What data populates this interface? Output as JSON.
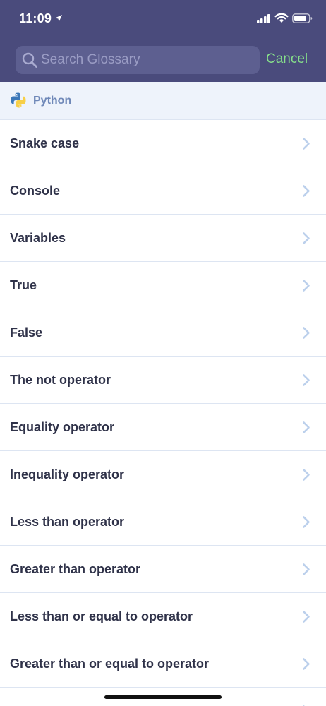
{
  "status_bar": {
    "time": "11:09"
  },
  "search": {
    "placeholder": "Search Glossary",
    "value": "",
    "cancel_label": "Cancel"
  },
  "section": {
    "title": "Python",
    "icon": "python-logo"
  },
  "items": [
    {
      "label": "Snake case"
    },
    {
      "label": "Console"
    },
    {
      "label": "Variables"
    },
    {
      "label": "True"
    },
    {
      "label": "False"
    },
    {
      "label": "The not operator"
    },
    {
      "label": "Equality operator"
    },
    {
      "label": "Inequality operator"
    },
    {
      "label": "Less than operator"
    },
    {
      "label": "Greater than operator"
    },
    {
      "label": "Less than or equal to operator"
    },
    {
      "label": "Greater than or equal to operator"
    }
  ],
  "colors": {
    "header_bg": "#4a4b7c",
    "search_bg": "#5d5f90",
    "accent_green": "#86e08a",
    "section_bg": "#eef3fb",
    "section_text": "#6f88b8",
    "item_text": "#2f3249",
    "chevron": "#bcd0ec"
  }
}
